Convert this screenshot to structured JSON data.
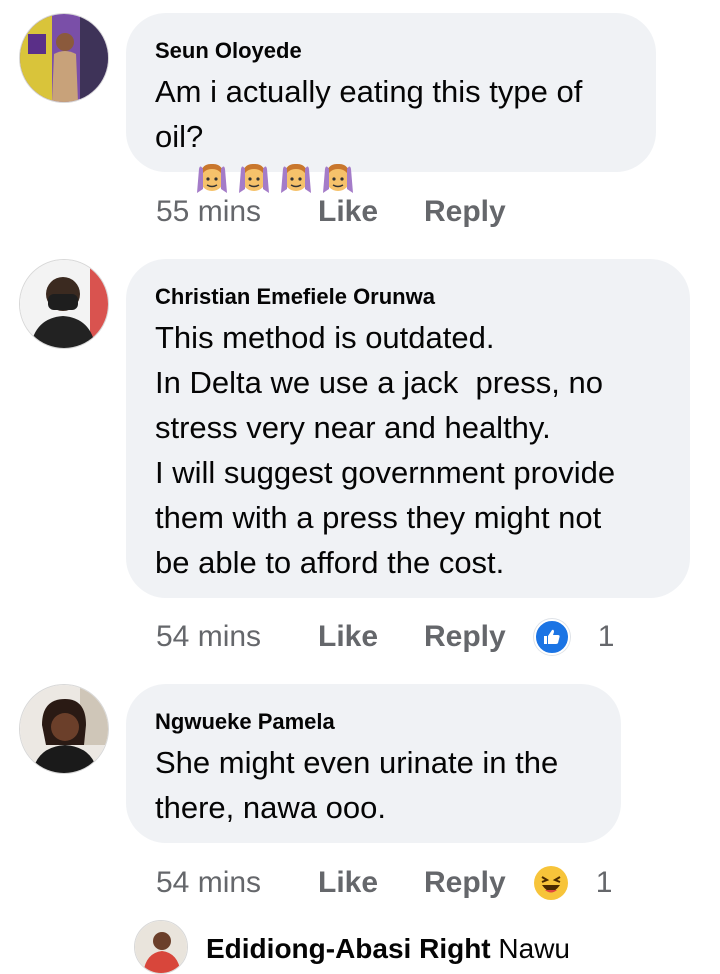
{
  "comments": [
    {
      "author": "Seun Oloyede",
      "lines": [
        "Am i actually eating this type of",
        "oil?"
      ],
      "emoji_after": [
        "person-raising-hands-emoji",
        "person-raising-hands-emoji",
        "person-raising-hands-emoji",
        "person-raising-hands-emoji"
      ],
      "time": "55 mins",
      "like_label": "Like",
      "reply_label": "Reply"
    },
    {
      "author": "Christian Emefiele Orunwa",
      "lines": [
        "This method is outdated.",
        "In Delta we use a jack  press, no",
        "stress very near and healthy.",
        "I will suggest government provide",
        "them with a press they might not",
        "be able to afford the cost."
      ],
      "time": "54 mins",
      "like_label": "Like",
      "reply_label": "Reply",
      "reaction_icon": "like-reaction-icon",
      "reaction_count": "1"
    },
    {
      "author": "Ngwueke Pamela",
      "lines": [
        "She might even urinate in the",
        "there, nawa ooo."
      ],
      "time": "54 mins",
      "like_label": "Like",
      "reply_label": "Reply",
      "reaction_icon": "haha-reaction-icon",
      "reaction_count": "1"
    }
  ],
  "reply_preview": {
    "author": "Edidiong-Abasi Right",
    "text": "Nawu"
  },
  "colors": {
    "bubble": "#f0f2f5",
    "meta_text": "#65676b",
    "like_blue": "#1b74e4",
    "haha_yellow": "#f7c43a"
  }
}
